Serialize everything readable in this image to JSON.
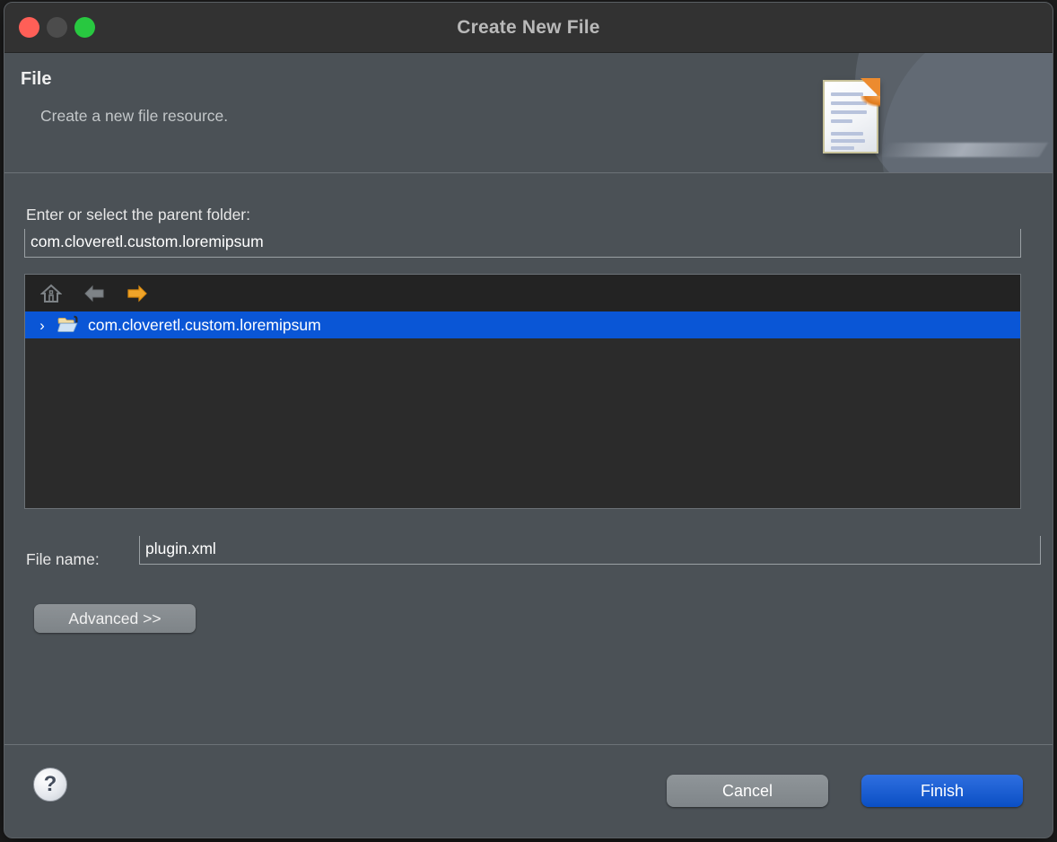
{
  "window": {
    "title": "Create New File",
    "traffic_lights": [
      {
        "name": "close",
        "color": "#ff5f57"
      },
      {
        "name": "minimize",
        "color": "#4c4c4c"
      },
      {
        "name": "maximize",
        "color": "#28c840"
      }
    ]
  },
  "banner": {
    "title": "File",
    "subtitle": "Create a new file resource.",
    "icon": "new-file-document-icon"
  },
  "form": {
    "parent_folder": {
      "label": "Enter or select the parent folder:",
      "value": "com.cloveretl.custom.loremipsum",
      "placeholder": ""
    },
    "file_name": {
      "label": "File name:",
      "value": "plugin.xml",
      "placeholder": ""
    },
    "advanced_label": "Advanced >>"
  },
  "tree": {
    "toolbar": [
      {
        "name": "home-icon",
        "label": "Home",
        "enabled": true
      },
      {
        "name": "back-arrow-icon",
        "label": "Back",
        "enabled": false
      },
      {
        "name": "forward-arrow-icon",
        "label": "Forward",
        "enabled": true
      }
    ],
    "items": [
      {
        "label": "com.cloveretl.custom.loremipsum",
        "icon": "open-folder-icon",
        "expanded": false,
        "selected": true
      }
    ],
    "selection_color": "#0a56d6"
  },
  "footer": {
    "help_label": "?",
    "cancel_label": "Cancel",
    "finish_label": "Finish",
    "finish_color": "#0a4fc4"
  }
}
